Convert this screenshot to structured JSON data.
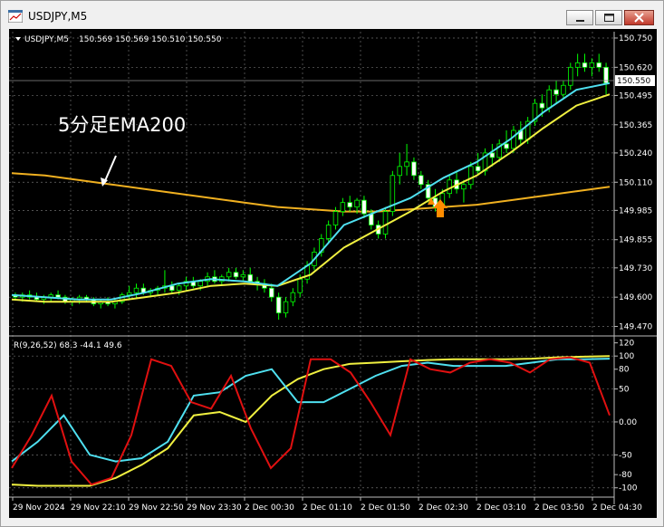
{
  "window": {
    "title": "USDJPY,M5"
  },
  "header": {
    "symbol_label": "USDJPY,M5",
    "ohlc": "150.569 150.569 150.510 150.550"
  },
  "annotation": {
    "text": "5分足EMA200"
  },
  "price_axis": {
    "ticks": [
      "150.750",
      "150.620",
      "150.495",
      "150.365",
      "150.240",
      "150.110",
      "149.985",
      "149.855",
      "149.730",
      "149.600",
      "149.470"
    ],
    "current_price_label": "150.550"
  },
  "oscillator": {
    "label": "R(9,26,52) 68.3 -44.1 49.6",
    "ticks": [
      "120",
      "100",
      "80",
      "50",
      "0.00",
      "-50",
      "-80",
      "-100"
    ]
  },
  "time_axis": {
    "labels": [
      "29 Nov 2024",
      "29 Nov 22:10",
      "29 Nov 22:50",
      "29 Nov 23:30",
      "2 Dec 00:30",
      "2 Dec 01:10",
      "2 Dec 01:50",
      "2 Dec 02:30",
      "2 Dec 03:10",
      "2 Dec 03:50",
      "2 Dec 04:30"
    ]
  },
  "colors": {
    "background": "#000000",
    "grid": "#6e6e6e",
    "candle": "#00ff00",
    "ema_fast": "#4fe0f0",
    "ema_slow": "#f0f040",
    "ema200": "#f0b020",
    "osc_red": "#e01010",
    "signal_arrow": "#ff8c00"
  },
  "chart_data": {
    "type": "candlestick",
    "symbol": "USDJPY",
    "timeframe": "M5",
    "y_range": [
      149.44,
      150.77
    ],
    "current_price": 150.55,
    "candles": [
      [
        149.61,
        149.62,
        149.59,
        149.6
      ],
      [
        149.6,
        149.62,
        149.58,
        149.61
      ],
      [
        149.61,
        149.63,
        149.59,
        149.6
      ],
      [
        149.6,
        149.62,
        149.58,
        149.59
      ],
      [
        149.59,
        149.61,
        149.57,
        149.6
      ],
      [
        149.6,
        149.62,
        149.58,
        149.61
      ],
      [
        149.61,
        149.63,
        149.59,
        149.6
      ],
      [
        149.6,
        149.61,
        149.57,
        149.58
      ],
      [
        149.58,
        149.6,
        149.56,
        149.59
      ],
      [
        149.59,
        149.61,
        149.57,
        149.6
      ],
      [
        149.6,
        149.61,
        149.58,
        149.59
      ],
      [
        149.59,
        149.6,
        149.56,
        149.57
      ],
      [
        149.57,
        149.59,
        149.55,
        149.58
      ],
      [
        149.58,
        149.6,
        149.56,
        149.57
      ],
      [
        149.57,
        149.59,
        149.55,
        149.58
      ],
      [
        149.58,
        149.62,
        149.57,
        149.61
      ],
      [
        149.61,
        149.65,
        149.59,
        149.62
      ],
      [
        149.62,
        149.66,
        149.6,
        149.64
      ],
      [
        149.64,
        149.66,
        149.61,
        149.62
      ],
      [
        149.62,
        149.64,
        149.6,
        149.63
      ],
      [
        149.63,
        149.65,
        149.61,
        149.64
      ],
      [
        149.64,
        149.72,
        149.62,
        149.65
      ],
      [
        149.65,
        149.67,
        149.62,
        149.63
      ],
      [
        149.63,
        149.66,
        149.61,
        149.65
      ],
      [
        149.65,
        149.69,
        149.63,
        149.67
      ],
      [
        149.67,
        149.69,
        149.64,
        149.65
      ],
      [
        149.65,
        149.68,
        149.63,
        149.67
      ],
      [
        149.67,
        149.71,
        149.65,
        149.69
      ],
      [
        149.69,
        149.72,
        149.66,
        149.67
      ],
      [
        149.67,
        149.7,
        149.65,
        149.69
      ],
      [
        149.69,
        149.73,
        149.67,
        149.71
      ],
      [
        149.71,
        149.73,
        149.68,
        149.69
      ],
      [
        149.69,
        149.72,
        149.67,
        149.7
      ],
      [
        149.7,
        149.73,
        149.66,
        149.67
      ],
      [
        149.67,
        149.69,
        149.63,
        149.66
      ],
      [
        149.66,
        149.68,
        149.62,
        149.64
      ],
      [
        149.64,
        149.66,
        149.58,
        149.6
      ],
      [
        149.6,
        149.62,
        149.5,
        149.53
      ],
      [
        149.53,
        149.6,
        149.51,
        149.58
      ],
      [
        149.58,
        149.64,
        149.56,
        149.62
      ],
      [
        149.62,
        149.7,
        149.6,
        149.68
      ],
      [
        149.68,
        149.76,
        149.66,
        149.74
      ],
      [
        149.74,
        149.82,
        149.72,
        149.8
      ],
      [
        149.8,
        149.88,
        149.78,
        149.86
      ],
      [
        149.86,
        149.94,
        149.84,
        149.92
      ],
      [
        149.92,
        150.0,
        149.9,
        149.98
      ],
      [
        149.98,
        150.04,
        149.96,
        150.02
      ],
      [
        150.02,
        150.05,
        149.98,
        150.0
      ],
      [
        150.0,
        150.04,
        149.97,
        150.03
      ],
      [
        150.03,
        150.05,
        149.95,
        149.97
      ],
      [
        149.97,
        149.99,
        149.9,
        149.92
      ],
      [
        149.92,
        149.94,
        149.86,
        149.88
      ],
      [
        149.88,
        150.0,
        149.86,
        149.98
      ],
      [
        149.98,
        150.16,
        149.96,
        150.14
      ],
      [
        150.14,
        150.24,
        150.1,
        150.18
      ],
      [
        150.18,
        150.28,
        150.14,
        150.2
      ],
      [
        150.2,
        150.22,
        150.12,
        150.14
      ],
      [
        150.14,
        150.16,
        150.08,
        150.1
      ],
      [
        150.1,
        150.12,
        150.02,
        150.04
      ],
      [
        150.04,
        150.08,
        149.98,
        150.0
      ],
      [
        150.0,
        150.08,
        149.98,
        150.06
      ],
      [
        150.06,
        150.14,
        150.04,
        150.12
      ],
      [
        150.12,
        150.16,
        150.06,
        150.08
      ],
      [
        150.08,
        150.12,
        150.02,
        150.1
      ],
      [
        150.1,
        150.2,
        150.08,
        150.18
      ],
      [
        150.18,
        150.24,
        150.14,
        150.16
      ],
      [
        150.16,
        150.26,
        150.14,
        150.24
      ],
      [
        150.24,
        150.28,
        150.18,
        150.22
      ],
      [
        150.22,
        150.3,
        150.2,
        150.28
      ],
      [
        150.28,
        150.34,
        150.24,
        150.26
      ],
      [
        150.26,
        150.36,
        150.24,
        150.34
      ],
      [
        150.34,
        150.38,
        150.28,
        150.3
      ],
      [
        150.3,
        150.4,
        150.28,
        150.38
      ],
      [
        150.38,
        150.48,
        150.36,
        150.46
      ],
      [
        150.46,
        150.5,
        150.4,
        150.44
      ],
      [
        150.44,
        150.54,
        150.42,
        150.52
      ],
      [
        150.52,
        150.56,
        150.46,
        150.5
      ],
      [
        150.5,
        150.56,
        150.48,
        150.54
      ],
      [
        150.54,
        150.64,
        150.52,
        150.62
      ],
      [
        150.62,
        150.68,
        150.58,
        150.64
      ],
      [
        150.64,
        150.68,
        150.6,
        150.62
      ],
      [
        150.62,
        150.66,
        150.58,
        150.64
      ],
      [
        150.64,
        150.68,
        150.6,
        150.62
      ],
      [
        150.62,
        150.64,
        150.5,
        150.55
      ]
    ],
    "ema200": [
      150.15,
      150.14,
      150.12,
      150.1,
      150.08,
      150.06,
      150.04,
      150.02,
      150.0,
      149.99,
      149.98,
      149.98,
      149.99,
      150.0,
      150.01,
      150.03,
      150.05,
      150.07,
      150.09
    ],
    "ema_fast": [
      149.61,
      149.6,
      149.59,
      149.59,
      149.62,
      149.66,
      149.68,
      149.67,
      149.65,
      149.75,
      149.92,
      149.98,
      150.04,
      150.13,
      150.2,
      150.3,
      150.42,
      150.52,
      150.55
    ],
    "ema_slow": [
      149.59,
      149.58,
      149.58,
      149.58,
      149.6,
      149.62,
      149.65,
      149.66,
      149.65,
      149.7,
      149.82,
      149.9,
      149.98,
      150.07,
      150.14,
      150.24,
      150.35,
      150.45,
      150.5
    ],
    "oscillator": {
      "ylim": [
        -110,
        125
      ],
      "red": [
        -70,
        -20,
        40,
        -60,
        -95,
        -85,
        -20,
        95,
        85,
        30,
        20,
        70,
        -10,
        -70,
        -40,
        95,
        95,
        75,
        30,
        -20,
        95,
        80,
        75,
        90,
        95,
        90,
        75,
        95,
        98,
        90,
        10
      ],
      "cyan": [
        -60,
        -30,
        10,
        -50,
        -60,
        -55,
        -30,
        40,
        45,
        70,
        80,
        30,
        30,
        50,
        70,
        85,
        90,
        85,
        85,
        85,
        90,
        95,
        95,
        96
      ],
      "yellow": [
        -95,
        -97,
        -97,
        -97,
        -85,
        -65,
        -40,
        10,
        15,
        0,
        40,
        65,
        80,
        88,
        90,
        92,
        94,
        95,
        95,
        95,
        96,
        98,
        99,
        100
      ]
    }
  }
}
